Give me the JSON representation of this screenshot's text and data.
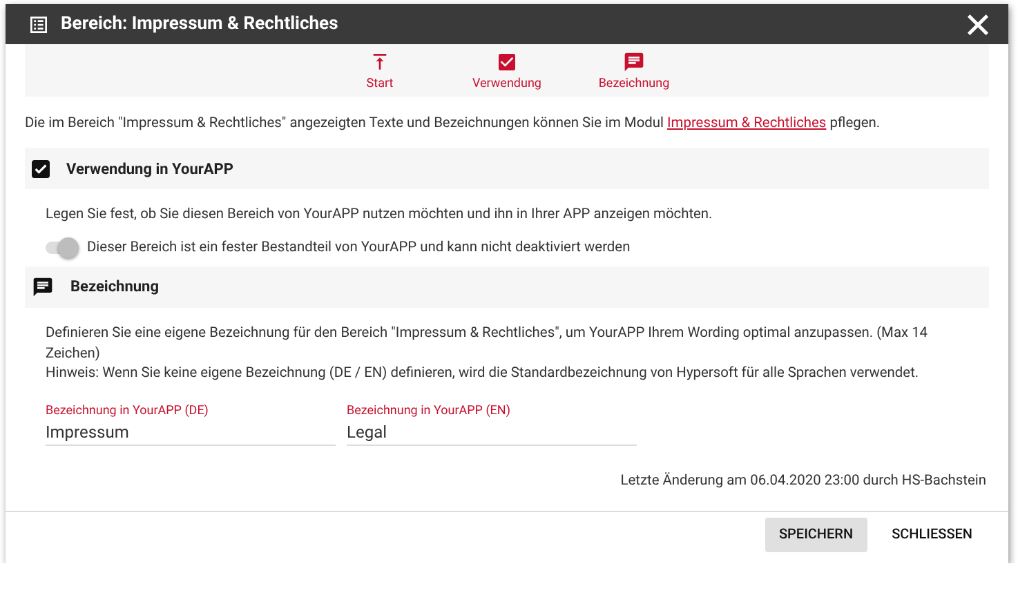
{
  "window": {
    "title": "Bereich: Impressum & Rechtliches"
  },
  "nav": [
    {
      "kind": "top",
      "label": "Start"
    },
    {
      "kind": "check",
      "label": "Verwendung"
    },
    {
      "kind": "comment",
      "label": "Bezeichnung"
    }
  ],
  "intro": {
    "before": "Die im Bereich \"Impressum & Rechtliches\" angezeigten Texte und Bezeichnungen können Sie im Modul",
    "link": "Impressum & Rechtliches",
    "after": "pflegen."
  },
  "sections": [
    {
      "kind": "usage",
      "checked": true,
      "title": "Verwendung in YourAPP",
      "text": "Legen Sie fest, ob Sie diesen Bereich von YourAPP nutzen möchten und ihn in Ihrer APP anzeigen möchten.",
      "toggle": {
        "on": true,
        "disabled": true,
        "label": "Dieser Bereich ist ein fester Bestandteil von YourAPP und kann nicht deaktiviert werden"
      }
    },
    {
      "kind": "naming",
      "title": "Bezeichnung",
      "text": "Definieren Sie eine eigene Bezeichnung für den Bereich \"Impressum & Rechtliches\", um YourAPP Ihrem Wording optimal anzupassen. (Max 14 Zeichen)\nHinweis: Wenn Sie keine eigene Bezeichnung (DE / EN) definieren, wird die Standardbezeichnung von Hypersoft für alle Sprachen verwendet.",
      "fields": [
        {
          "label": "Bezeichnung in YourAPP (DE)",
          "value": "Impressum"
        },
        {
          "label": "Bezeichnung in YourAPP (EN)",
          "value": "Legal"
        }
      ]
    }
  ],
  "last_change": "Letzte Änderung am 06.04.2020 23:00 durch HS-Bachstein",
  "buttons": [
    {
      "label": "SPEICHERN",
      "kind": "filled"
    },
    {
      "label": "SCHLIESSEN",
      "kind": "flat"
    }
  ]
}
